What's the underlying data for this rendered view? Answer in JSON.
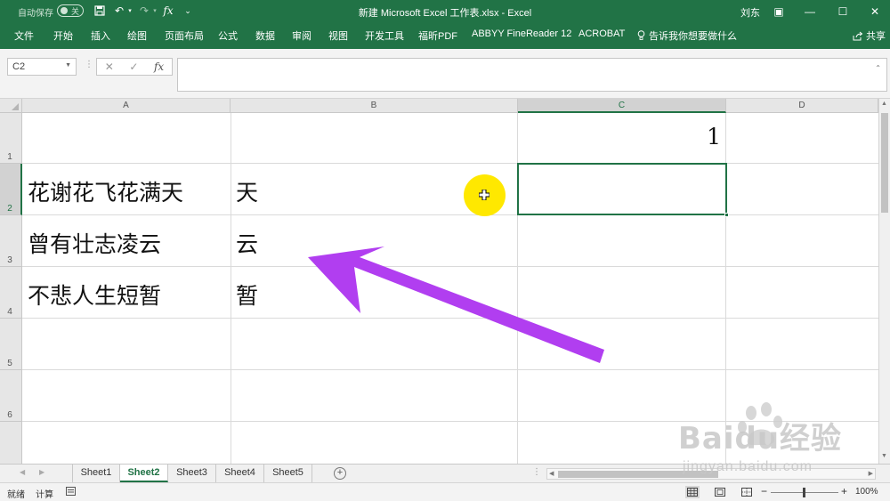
{
  "titlebar": {
    "autosave_label": "自动保存",
    "autosave_state": "关",
    "document_title": "新建 Microsoft Excel 工作表.xlsx  -  Excel",
    "user_name": "刘东",
    "undo_glyph": "↶",
    "redo_glyph": "↷",
    "fx_glyph": "fx",
    "more_glyph": "⌄",
    "minimize_glyph": "—",
    "maximize_glyph": "☐",
    "close_glyph": "✕",
    "ribbon_toggle_glyph": "▣"
  },
  "ribbon": {
    "tabs": [
      "文件",
      "开始",
      "插入",
      "绘图",
      "页面布局",
      "公式",
      "数据",
      "审阅",
      "视图",
      "开发工具",
      "福昕PDF",
      "ABBYY FineReader 12",
      "ACROBAT"
    ],
    "tell_me": "告诉我你想要做什么",
    "share": "共享"
  },
  "formula_bar": {
    "name_box": "C2",
    "cancel_glyph": "✕",
    "enter_glyph": "✓",
    "fx_glyph": "fx",
    "formula": ""
  },
  "grid": {
    "columns": [
      "A",
      "B",
      "C",
      "D"
    ],
    "rows": [
      "1",
      "2",
      "3",
      "4",
      "5",
      "6"
    ],
    "selected_cell": "C2",
    "cells": {
      "C1": "1",
      "A2": "花谢花飞花满天",
      "B2": "天",
      "A3": "曾有壮志凌云",
      "B3": "云",
      "A4": "不悲人生短暂",
      "B4": "暂"
    }
  },
  "sheets": {
    "tabs": [
      "Sheet1",
      "Sheet2",
      "Sheet3",
      "Sheet4",
      "Sheet5"
    ],
    "active": "Sheet2",
    "add_glyph": "+"
  },
  "statusbar": {
    "mode": "就绪",
    "calc": "计算",
    "zoom": "100%",
    "zoom_minus": "−",
    "zoom_plus": "+"
  },
  "colors": {
    "accent": "#217346",
    "arrow": "#b13ef0",
    "cursor_highlight": "#ffe800"
  },
  "watermark": {
    "logo": "Baidu经验",
    "url": "jingyan.baidu.com"
  }
}
